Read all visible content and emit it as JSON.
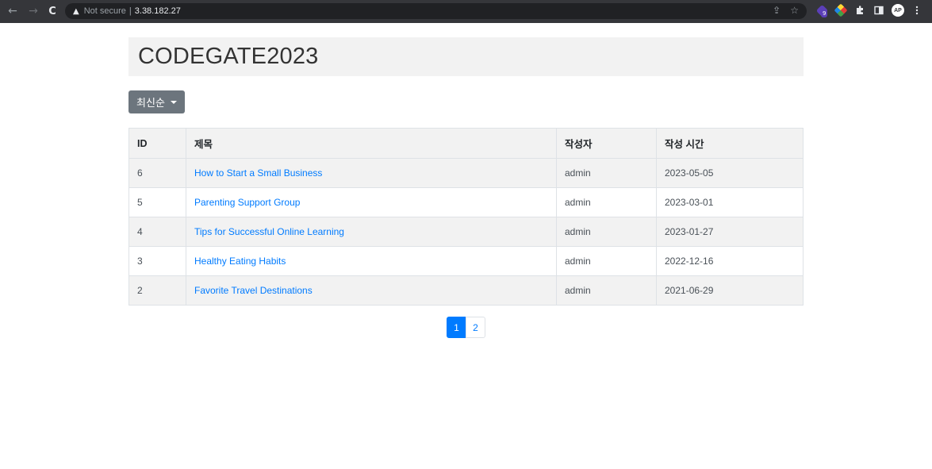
{
  "browser": {
    "back_icon": "←",
    "forward_icon": "→",
    "reload_icon": "C",
    "warning_icon": "▲",
    "security_label": "Not secure",
    "separator": "|",
    "url": "3.38.182.27",
    "ext_badge": "9",
    "avatar_initials": "AP"
  },
  "page": {
    "title": "CODEGATE2023",
    "sort_label": "최신순"
  },
  "table": {
    "headers": {
      "id": "ID",
      "title": "제목",
      "author": "작성자",
      "time": "작성 시간"
    },
    "rows": [
      {
        "id": "6",
        "title": "How to Start a Small Business",
        "author": "admin",
        "time": "2023-05-05"
      },
      {
        "id": "5",
        "title": "Parenting Support Group",
        "author": "admin",
        "time": "2023-03-01"
      },
      {
        "id": "4",
        "title": "Tips for Successful Online Learning",
        "author": "admin",
        "time": "2023-01-27"
      },
      {
        "id": "3",
        "title": "Healthy Eating Habits",
        "author": "admin",
        "time": "2022-12-16"
      },
      {
        "id": "2",
        "title": "Favorite Travel Destinations",
        "author": "admin",
        "time": "2021-06-29"
      }
    ]
  },
  "pagination": {
    "pages": [
      "1",
      "2"
    ],
    "current": "1"
  },
  "colors": {
    "primary": "#007bff",
    "secondary": "#6c757d",
    "stripe": "#f2f2f2"
  }
}
